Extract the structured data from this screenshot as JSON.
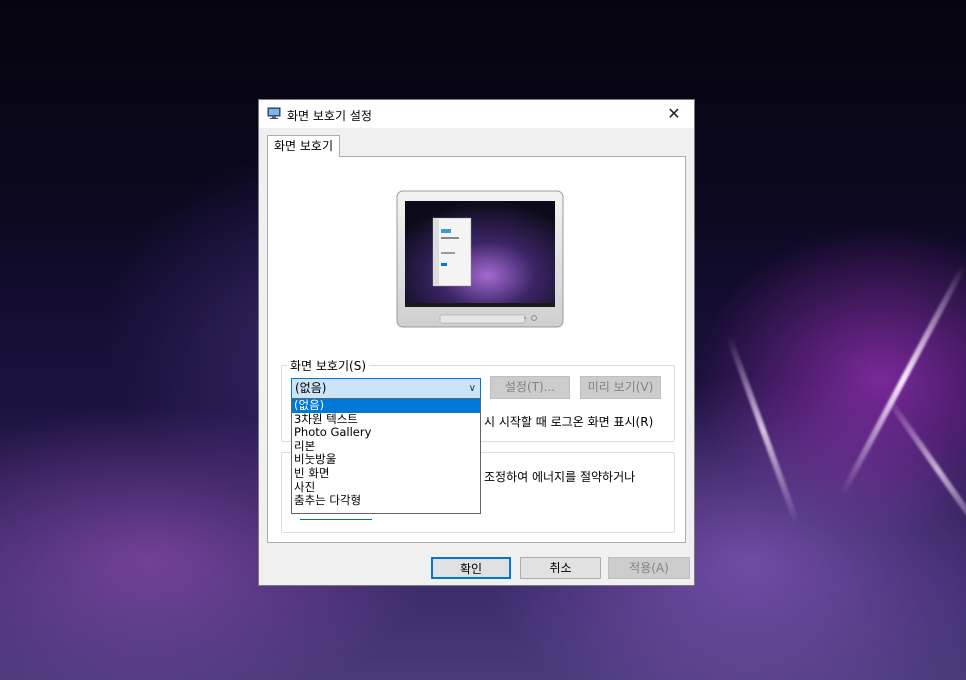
{
  "window": {
    "title": "화면 보호기 설정",
    "close_glyph": "✕",
    "icon": "display-settings-icon"
  },
  "tab": {
    "label": "화면 보호기"
  },
  "screensaver_group": {
    "label": "화면 보호기(S)",
    "selected_value": "(없음)",
    "settings_label": "설정(T)...",
    "preview_label": "미리 보기(V)",
    "resume_text": "시 시작할 때 로그온 화면 표시(R)"
  },
  "dropdown": {
    "items": [
      "(없음)",
      "3차원 텍스트",
      "Photo Gallery",
      "리본",
      "비눗방울",
      "빈 화면",
      "사진",
      "춤추는 다각형"
    ],
    "selected_index": 0
  },
  "power_group": {
    "text": "조정하여 에너지를 절약하거나"
  },
  "buttons": {
    "ok": "확인",
    "cancel": "취소",
    "apply": "적용(A)"
  },
  "colors": {
    "accent": "#0078d7",
    "selection_bg": "#cce4f7",
    "link": "#0066cc"
  }
}
